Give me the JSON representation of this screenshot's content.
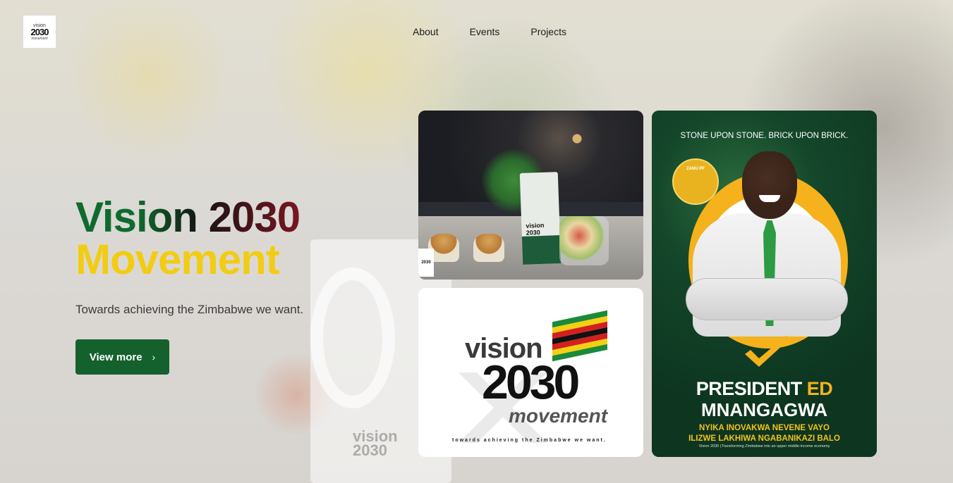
{
  "logo": {
    "top_text": "vision",
    "number": "2030",
    "bottom_text": "movement"
  },
  "nav": {
    "items": [
      "About",
      "Events",
      "Projects"
    ]
  },
  "hero": {
    "title_line1": "Vision 2030",
    "title_line2": "Movement",
    "subtitle": "Towards achieving the Zimbabwe we want.",
    "cta_label": "View more",
    "cta_icon": "chevron-right-icon"
  },
  "gallery": {
    "photo_card": {
      "bag_text": "vision 2030",
      "mini_logo_text": "2030"
    },
    "logo_card": {
      "vision": "vision",
      "number": "2030",
      "movement": "movement",
      "tagline": "towards achieving the Zimbabwe we want."
    },
    "poster": {
      "header": "STONE UPON STONE. BRICK UPON BRICK.",
      "badge": "ZANU PF",
      "name_line1_a": "PRESIDENT ",
      "name_line1_b": "ED",
      "name_line2": "MNANGAGWA",
      "slogan_line1": "NYIKA INOVAKWA NEVENE VAYO",
      "slogan_line2": "ILIZWE LAKHIWA NGABANIKAZI BALO",
      "footer": "Vision 2030 (Transforming Zimbabwe into an upper middle-income economy"
    }
  },
  "colors": {
    "green": "#14612e",
    "yellow": "#f2cc14",
    "maroon": "#7a1520",
    "poster_gold": "#f5b21c"
  }
}
